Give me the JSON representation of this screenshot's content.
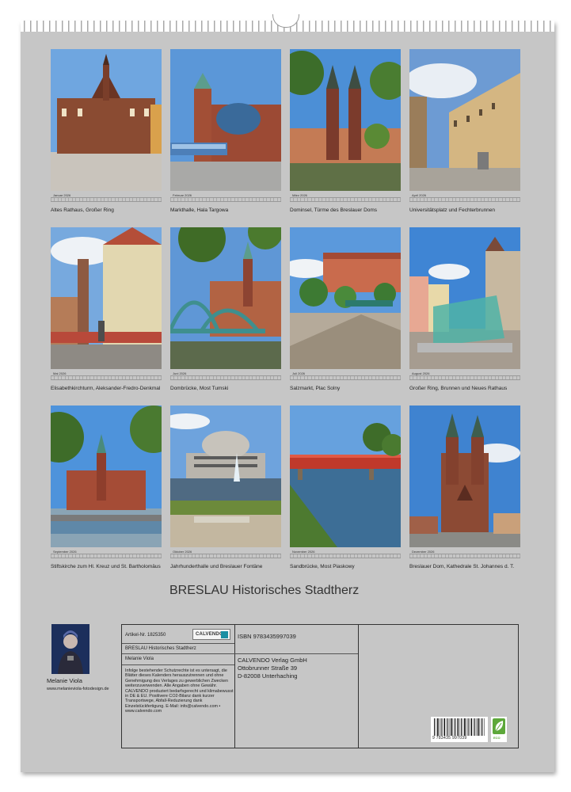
{
  "title": "BRESLAU Historisches Stadtherz",
  "months": [
    {
      "name": "Januar 2026",
      "caption": "Altes Rathaus, Großer Ring"
    },
    {
      "name": "Februar 2026",
      "caption": "Markthalle, Hala Targowa"
    },
    {
      "name": "März 2026",
      "caption": "Dominsel, Türme des Breslauer Doms"
    },
    {
      "name": "April 2026",
      "caption": "Universitätsplatz und Fechterbrunnen"
    },
    {
      "name": "Mai 2026",
      "caption": "Elisabethkirchturm, Aleksander-Fredro-Denkmal"
    },
    {
      "name": "Juni 2026",
      "caption": "Dombrücke, Most Tumski"
    },
    {
      "name": "Juli 2026",
      "caption": "Salzmarkt, Plac Solny"
    },
    {
      "name": "August 2026",
      "caption": "Großer Ring, Brunnen und Neues Rathaus"
    },
    {
      "name": "September 2026",
      "caption": "Stiftskirche zum Hl. Kreuz und St. Bartholomäus"
    },
    {
      "name": "Oktober 2026",
      "caption": "Jahrhunderthalle und Breslauer Fontäne"
    },
    {
      "name": "November 2026",
      "caption": "Sandbrücke, Most Piaskowy"
    },
    {
      "name": "Dezember 2026",
      "caption": "Breslauer Dom, Kathedrale St. Johannes d. T."
    }
  ],
  "author": {
    "name": "Melanie Viola",
    "website": "www.melanieviola-fotodesign.de"
  },
  "info": {
    "article": "Artikel-Nr. 1825350",
    "logo": "CALVENDO",
    "product_title": "BRESLAU Historisches Stadtherz",
    "author": "Melanie Viola",
    "legal": "Infolge bestehender Schutzrechte ist es untersagt, die Blätter dieses Kalenders herauszutrennen und ohne Genehmigung des Verlages zu gewerblichen Zwecken weiterzuverwenden. Alle Angaben ohne Gewähr. CALVENDO produziert bedarfsgerecht und klimabewusst in DE & EU. Positivere CO2-Bilanz dank kurzer Transportwege, Abfall-Reduzierung dank Einzelstückfertigung. E-Mail: info@calvendo.com • www.calvendo.com",
    "isbn": "ISBN 9783435997039",
    "publisher": "CALVENDO Verlag GmbH",
    "street": "Ottobrunner Straße 39",
    "city": "D-82008 Unterhaching",
    "barcode": "9 783435 997039",
    "eco": "ECO"
  }
}
